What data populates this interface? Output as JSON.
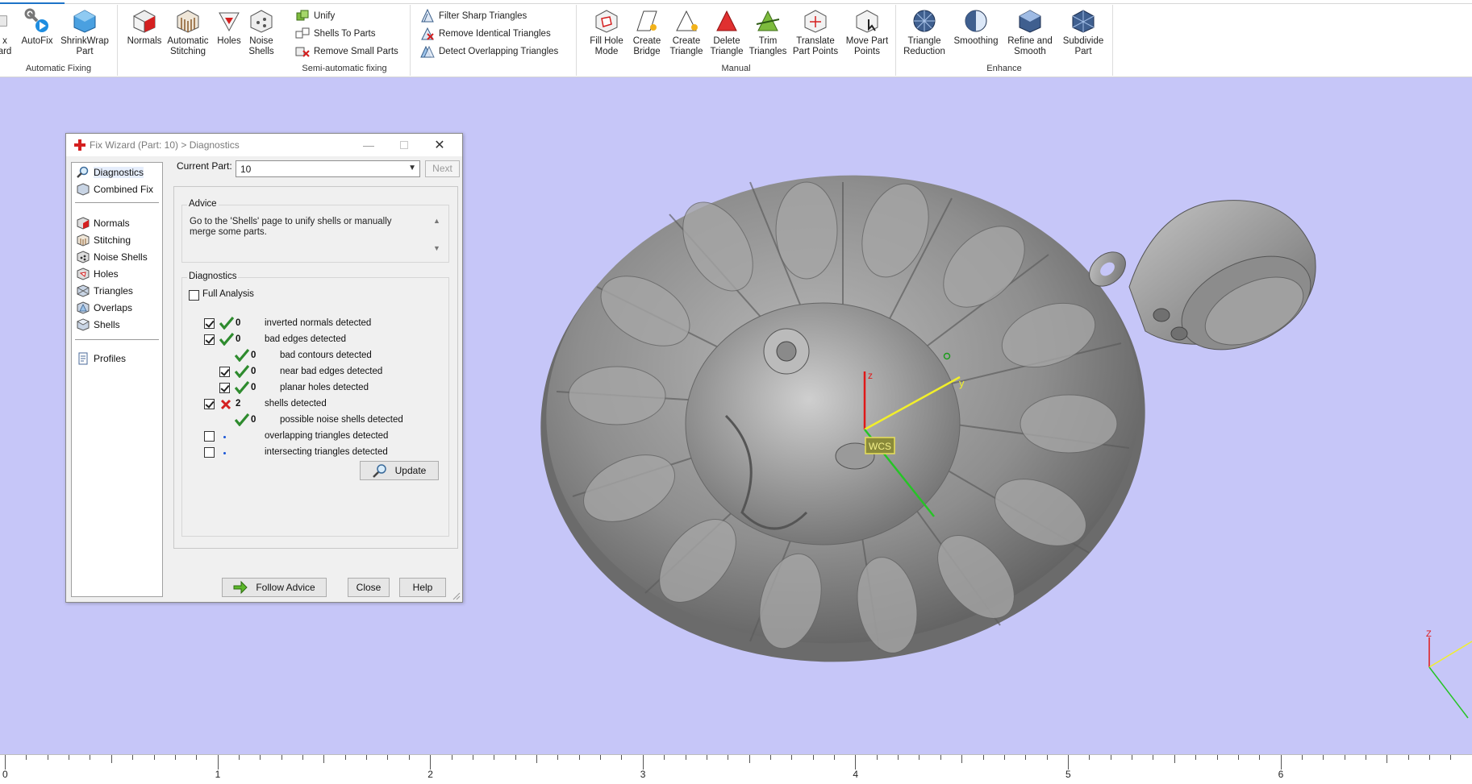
{
  "ribbon": {
    "groups": [
      {
        "title": "Automatic Fixing"
      },
      {
        "title": "Semi-automatic fixing"
      },
      {
        "title": "Manual"
      },
      {
        "title": "Enhance"
      }
    ],
    "buttons": {
      "fix_wizard": [
        "x",
        "ard"
      ],
      "autofix": [
        "AutoFix"
      ],
      "shrinkwrap": [
        "ShrinkWrap",
        "Part"
      ],
      "normals": [
        "Normals"
      ],
      "automatic_stitching": [
        "Automatic",
        "Stitching"
      ],
      "holes": [
        "Holes"
      ],
      "noise_shells": [
        "Noise",
        "Shells"
      ],
      "fill_hole_mode": [
        "Fill Hole",
        "Mode"
      ],
      "create_bridge": [
        "Create",
        "Bridge"
      ],
      "create_triangle": [
        "Create",
        "Triangle"
      ],
      "delete_triangle": [
        "Delete",
        "Triangle"
      ],
      "trim_triangles": [
        "Trim",
        "Triangles"
      ],
      "translate_part_points": [
        "Translate",
        "Part Points"
      ],
      "move_part_points": [
        "Move Part",
        "Points"
      ],
      "triangle_reduction": [
        "Triangle",
        "Reduction"
      ],
      "smoothing": [
        "Smoothing"
      ],
      "refine_and_smooth": [
        "Refine and",
        "Smooth"
      ],
      "subdivide_part": [
        "Subdivide",
        "Part"
      ]
    },
    "small_buttons": {
      "unify": "Unify",
      "shells_to_parts": "Shells To Parts",
      "remove_small_parts": "Remove Small Parts",
      "filter_sharp_triangles": "Filter Sharp Triangles",
      "remove_identical_triangles": "Remove Identical Triangles",
      "detect_overlapping_triangles": "Detect Overlapping Triangles"
    }
  },
  "dialog": {
    "title": "Fix Wizard (Part: 10) > Diagnostics",
    "nav": {
      "diagnostics": "Diagnostics",
      "combined_fix": "Combined Fix",
      "normals": "Normals",
      "stitching": "Stitching",
      "noise_shells": "Noise Shells",
      "holes": "Holes",
      "triangles": "Triangles",
      "overlaps": "Overlaps",
      "shells": "Shells",
      "profiles": "Profiles"
    },
    "current_part_label": "Current Part:",
    "current_part_value": "10",
    "next_label": "Next",
    "advice_title": "Advice",
    "advice_text": "Go to the 'Shells' page to unify shells or manually merge some parts.",
    "diagnostics_title": "Diagnostics",
    "full_analysis_label": "Full Analysis",
    "rows": [
      {
        "count": "0",
        "label": "inverted normals detected",
        "status": "ok",
        "checked": true
      },
      {
        "count": "0",
        "label": "bad edges detected",
        "status": "ok",
        "checked": true
      },
      {
        "count": "0",
        "label": "bad contours detected",
        "status": "ok",
        "checked": null
      },
      {
        "count": "0",
        "label": "near bad edges detected",
        "status": "ok",
        "checked": true
      },
      {
        "count": "0",
        "label": "planar holes detected",
        "status": "ok",
        "checked": true
      },
      {
        "count": "2",
        "label": "shells detected",
        "status": "error",
        "checked": true
      },
      {
        "count": "0",
        "label": "possible noise shells detected",
        "status": "ok",
        "checked": null
      },
      {
        "count": "",
        "label": "overlapping triangles detected",
        "status": "none",
        "checked": false
      },
      {
        "count": "",
        "label": "intersecting triangles detected",
        "status": "none",
        "checked": false
      }
    ],
    "update_label": "Update",
    "follow_advice_label": "Follow Advice",
    "close_label": "Close",
    "help_label": "Help"
  },
  "viewport": {
    "axis_labels": {
      "z": "z",
      "y": "y",
      "wcs": "WCS",
      "mini_z": "Z"
    }
  },
  "ruler": {
    "labels": [
      "0",
      "1",
      "2",
      "3",
      "4",
      "5",
      "6"
    ]
  },
  "colors": {
    "viewport_bg": "#c6c6f8",
    "ok_green": "#2e8b2e",
    "error_red": "#d42020",
    "accent_blue": "#1e73c8"
  }
}
